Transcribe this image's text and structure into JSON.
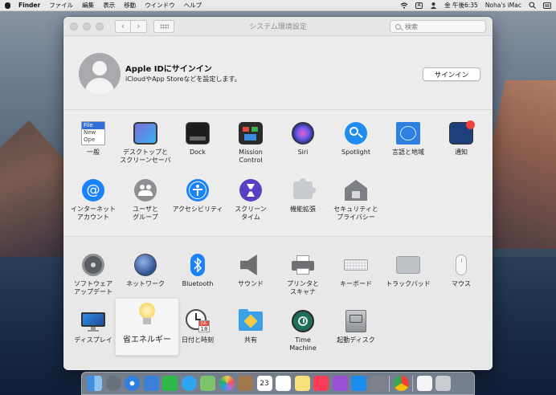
{
  "menubar": {
    "app_name": "Finder",
    "items": [
      "ファイル",
      "編集",
      "表示",
      "移動",
      "ウインドウ",
      "ヘルプ"
    ],
    "input_indicator": "A",
    "clock": "金 午後6:35",
    "user": "Noha's iMac"
  },
  "window": {
    "title": "システム環境設定",
    "search_placeholder": "検索",
    "back_glyph": "‹",
    "forward_glyph": "›"
  },
  "apple_id": {
    "title": "Apple IDにサインイン",
    "subtitle": "iCloudやApp Storeなどを設定します。",
    "button": "サインイン"
  },
  "panes": {
    "row1": [
      {
        "label": "一般",
        "icon": "general-icon"
      },
      {
        "label": "デスクトップと\nスクリーンセーバ",
        "icon": "desktop-icon"
      },
      {
        "label": "Dock",
        "icon": "dock-icon"
      },
      {
        "label": "Mission\nControl",
        "icon": "mission-control-icon"
      },
      {
        "label": "Siri",
        "icon": "siri-icon"
      },
      {
        "label": "Spotlight",
        "icon": "spotlight-icon"
      },
      {
        "label": "言語と地域",
        "icon": "language-region-icon"
      },
      {
        "label": "通知",
        "icon": "notifications-icon"
      }
    ],
    "row2": [
      {
        "label": "インターネット\nアカウント",
        "icon": "internet-accounts-icon"
      },
      {
        "label": "ユーザと\nグループ",
        "icon": "users-groups-icon"
      },
      {
        "label": "アクセシビリティ",
        "icon": "accessibility-icon"
      },
      {
        "label": "スクリーン\nタイム",
        "icon": "screen-time-icon"
      },
      {
        "label": "機能拡張",
        "icon": "extensions-icon"
      },
      {
        "label": "セキュリティと\nプライバシー",
        "icon": "security-privacy-icon"
      }
    ],
    "row3": [
      {
        "label": "ソフトウェア\nアップデート",
        "icon": "software-update-icon"
      },
      {
        "label": "ネットワーク",
        "icon": "network-icon"
      },
      {
        "label": "Bluetooth",
        "icon": "bluetooth-icon"
      },
      {
        "label": "サウンド",
        "icon": "sound-icon"
      },
      {
        "label": "プリンタと\nスキャナ",
        "icon": "printers-scanners-icon"
      },
      {
        "label": "キーボード",
        "icon": "keyboard-icon"
      },
      {
        "label": "トラックパッド",
        "icon": "trackpad-icon"
      },
      {
        "label": "マウス",
        "icon": "mouse-icon"
      }
    ],
    "row4": [
      {
        "label": "ディスプレイ",
        "icon": "displays-icon"
      },
      {
        "label": "省エネルギー",
        "icon": "energy-saver-icon"
      },
      {
        "label": "日付と時刻",
        "icon": "date-time-icon"
      },
      {
        "label": "共有",
        "icon": "sharing-icon"
      },
      {
        "label": "Time\nMachine",
        "icon": "time-machine-icon"
      },
      {
        "label": "起動ディスク",
        "icon": "startup-disk-icon"
      }
    ]
  },
  "icon_text": {
    "general": "File",
    "general_2": "New",
    "general_3": "Ope",
    "date_month": "JUL",
    "date_day": "18",
    "calendar_day": "23"
  },
  "colors": {
    "accent": "#1a82fb",
    "window_bg": "#ececec"
  }
}
